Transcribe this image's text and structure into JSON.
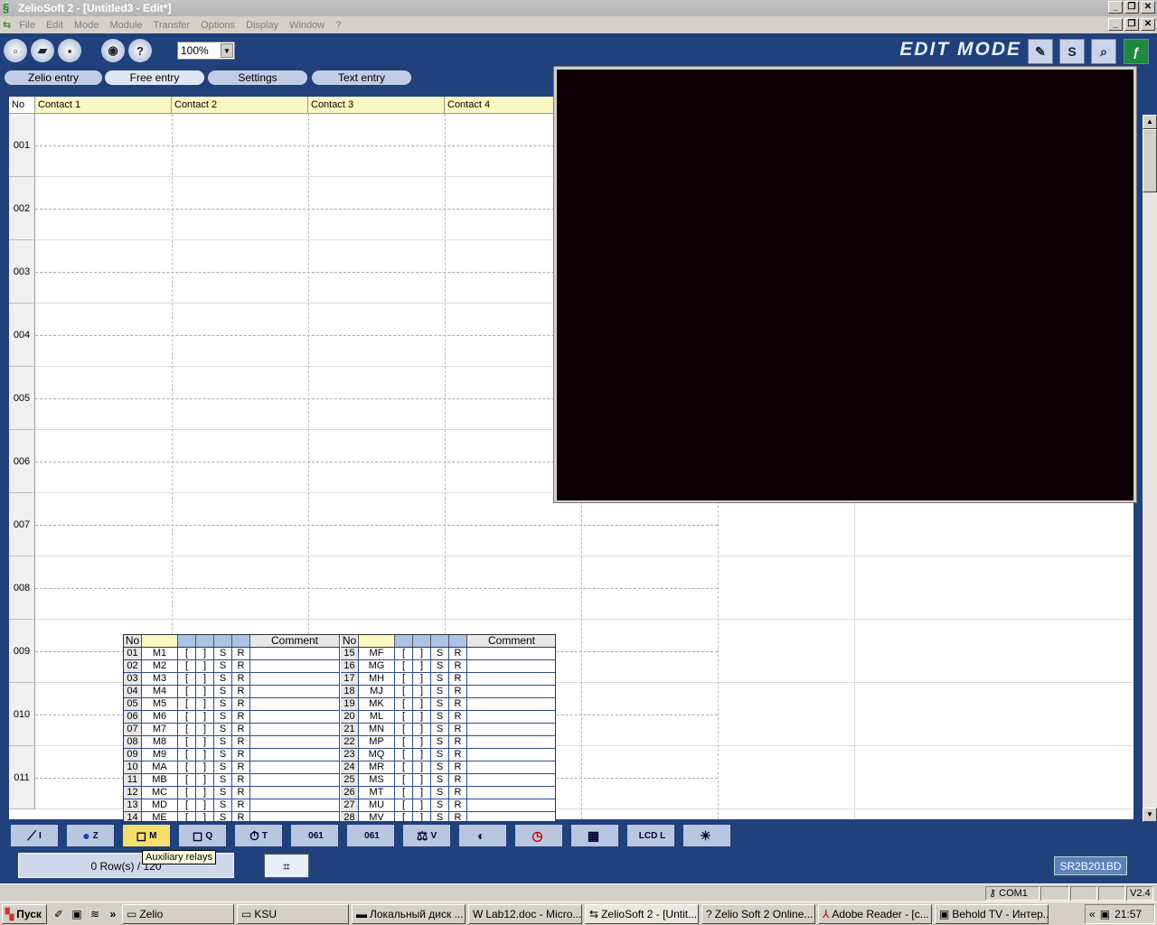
{
  "window": {
    "title": "ZelioSoft 2 - [Untitled3 - Edit*]"
  },
  "menu": [
    "File",
    "Edit",
    "Mode",
    "Module",
    "Transfer",
    "Options",
    "Display",
    "Window",
    "?"
  ],
  "toolbar": {
    "zoom": "100%",
    "mode_label": "EDIT MODE",
    "simulation_label": "S"
  },
  "tabs": [
    "Zelio entry",
    "Free entry",
    "Settings",
    "Text entry"
  ],
  "grid": {
    "headers": [
      "No",
      "Contact 1",
      "Contact 2",
      "Contact 3",
      "Contact 4"
    ],
    "rows": [
      "001",
      "002",
      "003",
      "004",
      "005",
      "006",
      "007",
      "008",
      "009",
      "010",
      "011"
    ]
  },
  "relays": {
    "header_no": "No",
    "header_comment": "Comment",
    "left": [
      {
        "n": "01",
        "name": "M1"
      },
      {
        "n": "02",
        "name": "M2"
      },
      {
        "n": "03",
        "name": "M3"
      },
      {
        "n": "04",
        "name": "M4"
      },
      {
        "n": "05",
        "name": "M5"
      },
      {
        "n": "06",
        "name": "M6"
      },
      {
        "n": "07",
        "name": "M7"
      },
      {
        "n": "08",
        "name": "M8"
      },
      {
        "n": "09",
        "name": "M9"
      },
      {
        "n": "10",
        "name": "MA"
      },
      {
        "n": "11",
        "name": "MB"
      },
      {
        "n": "12",
        "name": "MC"
      },
      {
        "n": "13",
        "name": "MD"
      },
      {
        "n": "14",
        "name": "ME"
      }
    ],
    "right": [
      {
        "n": "15",
        "name": "MF"
      },
      {
        "n": "16",
        "name": "MG"
      },
      {
        "n": "17",
        "name": "MH"
      },
      {
        "n": "18",
        "name": "MJ"
      },
      {
        "n": "19",
        "name": "MK"
      },
      {
        "n": "20",
        "name": "ML"
      },
      {
        "n": "21",
        "name": "MN"
      },
      {
        "n": "22",
        "name": "MP"
      },
      {
        "n": "23",
        "name": "MQ"
      },
      {
        "n": "24",
        "name": "MR"
      },
      {
        "n": "25",
        "name": "MS"
      },
      {
        "n": "26",
        "name": "MT"
      },
      {
        "n": "27",
        "name": "MU"
      },
      {
        "n": "28",
        "name": "MV"
      }
    ],
    "symbols": [
      "[",
      "]",
      "S",
      "R"
    ]
  },
  "function_bar": [
    {
      "icon": "contact-icon",
      "label": "I"
    },
    {
      "icon": "zx-key-icon",
      "label": "Z"
    },
    {
      "icon": "auxiliary-relay-icon",
      "label": "M"
    },
    {
      "icon": "output-coil-icon",
      "label": "Q"
    },
    {
      "icon": "timer-icon",
      "label": "T"
    },
    {
      "icon": "counter-icon",
      "label": "061"
    },
    {
      "icon": "fast-counter-icon",
      "label": "061"
    },
    {
      "icon": "comparator-icon",
      "label": "V"
    },
    {
      "icon": "analog-icon",
      "label": ""
    },
    {
      "icon": "clock-icon",
      "label": ""
    },
    {
      "icon": "text-icon",
      "label": ""
    },
    {
      "icon": "lcd-icon",
      "label": "LCD L"
    },
    {
      "icon": "backlight-icon",
      "label": ""
    }
  ],
  "tooltip": "Auxiliary relays",
  "status": {
    "rows": "0 Row(s) / 120",
    "model": "SR2B201BD",
    "port": "COM1",
    "version": "V2.4"
  },
  "taskbar": {
    "start": "Пуск",
    "tasks": [
      "Zelio",
      "KSU",
      "Локальный диск ...",
      "Lab12.doc - Micro...",
      "ZelioSoft 2 - [Untit...",
      "Zelio Soft 2 Online...",
      "Adobe Reader - [c...",
      "Behold TV - Интер..."
    ],
    "clock": "21:57"
  }
}
